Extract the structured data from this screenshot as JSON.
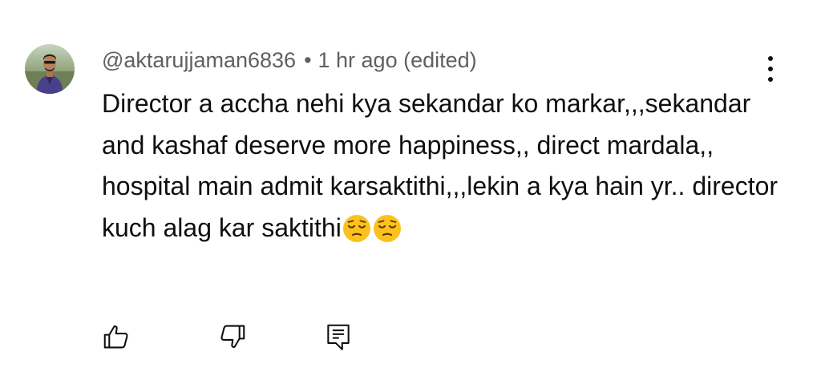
{
  "comment": {
    "author": "@aktarujjaman6836",
    "separator": "•",
    "timestamp": "1 hr ago (edited)",
    "text": "Director a accha nehi kya sekandar ko markar,,,sekandar and kashaf deserve more happiness,, direct mardala,, hospital main admit karsaktithi,,,lekin a kya hain yr.. director kuch alag kar saktithi",
    "trailing_emoji": [
      "pensive-face",
      "pensive-face"
    ]
  },
  "actions": {
    "like_icon": "thumb-up-icon",
    "dislike_icon": "thumb-down-icon",
    "reply_icon": "comment-reply-icon"
  },
  "menu_icon": "more-vert-icon"
}
